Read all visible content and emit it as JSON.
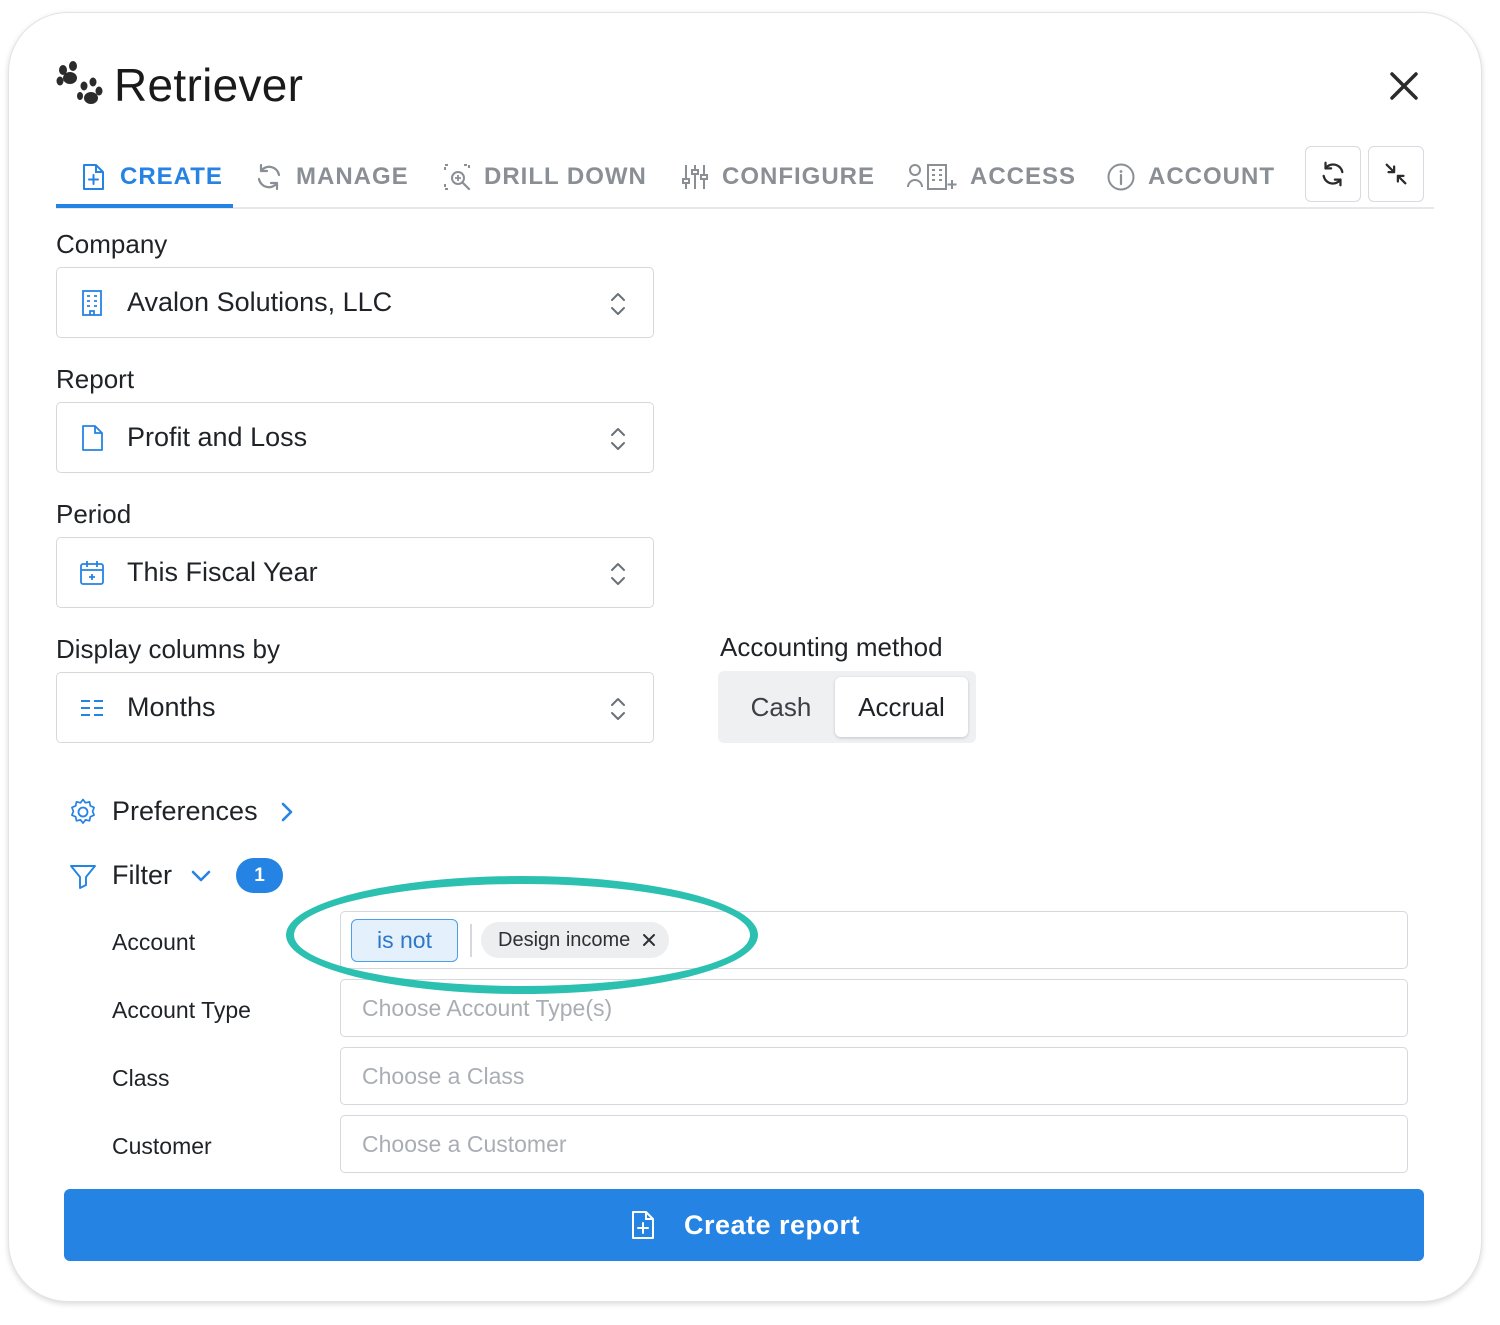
{
  "app": {
    "name": "Retriever"
  },
  "tabs": [
    {
      "label": "CREATE",
      "icon": "file-plus-icon",
      "active": true
    },
    {
      "label": "MANAGE",
      "icon": "refresh-icon"
    },
    {
      "label": "DRILL DOWN",
      "icon": "drill-down-icon"
    },
    {
      "label": "CONFIGURE",
      "icon": "sliders-icon"
    },
    {
      "label": "ACCESS",
      "icon": "user-building-icon"
    },
    {
      "label": "ACCOUNT",
      "icon": "info-icon"
    }
  ],
  "form": {
    "company": {
      "label": "Company",
      "value": "Avalon Solutions, LLC",
      "icon": "building-icon"
    },
    "report": {
      "label": "Report",
      "value": "Profit and Loss",
      "icon": "document-icon"
    },
    "period": {
      "label": "Period",
      "value": "This Fiscal Year",
      "icon": "calendar-icon"
    },
    "display_columns": {
      "label": "Display columns by",
      "value": "Months",
      "icon": "columns-icon"
    },
    "accounting_method": {
      "label": "Accounting method",
      "options": [
        "Cash",
        "Accrual"
      ],
      "selected": "Accrual"
    }
  },
  "preferences": {
    "label": "Preferences"
  },
  "filter": {
    "label": "Filter",
    "count": "1",
    "rows": {
      "account": {
        "label": "Account",
        "operator": "is not",
        "tag": "Design income"
      },
      "account_type": {
        "label": "Account Type",
        "placeholder": "Choose Account Type(s)"
      },
      "class": {
        "label": "Class",
        "placeholder": "Choose a Class"
      },
      "customer": {
        "label": "Customer",
        "placeholder": "Choose a Customer"
      }
    }
  },
  "actions": {
    "create_report": "Create report"
  },
  "colors": {
    "accent": "#2583e3",
    "highlight": "#2cc0b0"
  }
}
